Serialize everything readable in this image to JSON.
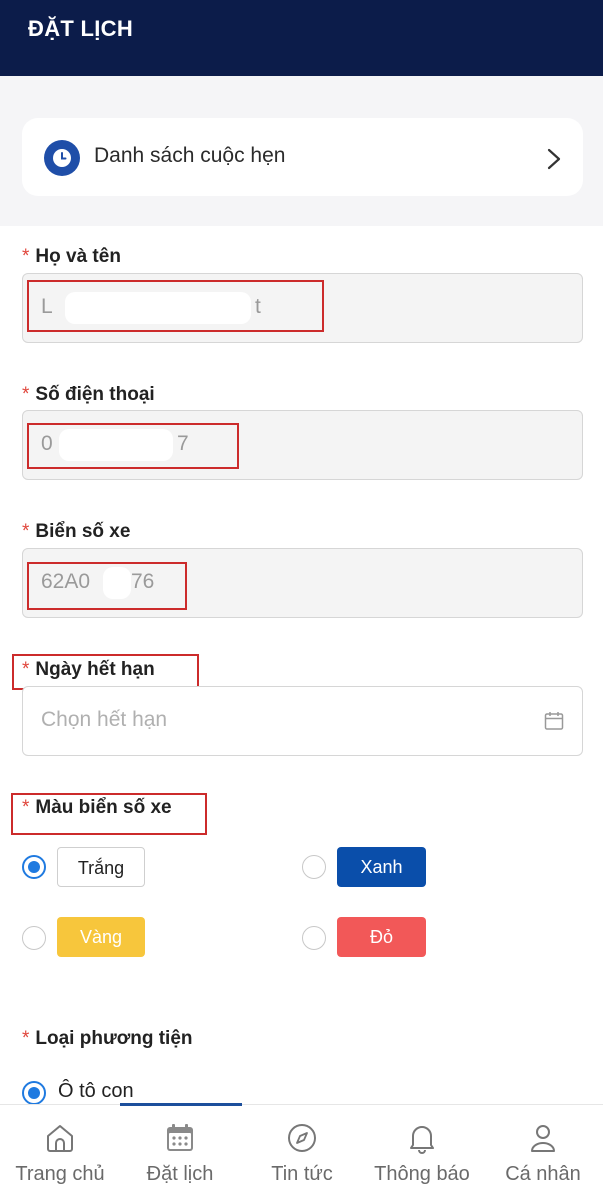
{
  "header": {
    "title": "ĐẶT LỊCH"
  },
  "appointments": {
    "label": "Danh sách cuộc hẹn"
  },
  "form": {
    "required_mark": "*",
    "full_name": {
      "label": "Họ và tên",
      "value_start": "L",
      "value_end": "t"
    },
    "phone": {
      "label": "Số điện thoại",
      "value_start": "0",
      "value_end": "7"
    },
    "plate": {
      "label": "Biển số xe",
      "value_start": "62A0",
      "value_end": "76"
    },
    "expiry": {
      "label": "Ngày hết hạn",
      "placeholder": "Chọn hết hạn"
    },
    "plate_color": {
      "label": "Màu biển số xe",
      "options": [
        {
          "label": "Trắng",
          "selected": true,
          "bg": "#ffffff",
          "fg": "#222222"
        },
        {
          "label": "Xanh",
          "selected": false,
          "bg": "#0a4eaa",
          "fg": "#ffffff"
        },
        {
          "label": "Vàng",
          "selected": false,
          "bg": "#f7c63c",
          "fg": "#ffffff"
        },
        {
          "label": "Đỏ",
          "selected": false,
          "bg": "#f25858",
          "fg": "#ffffff"
        }
      ]
    },
    "vehicle_type": {
      "label": "Loại phương tiện",
      "option": "Ô tô con"
    }
  },
  "bottom_nav": {
    "items": [
      {
        "label": "Trang chủ",
        "icon": "home-icon"
      },
      {
        "label": "Đặt lịch",
        "icon": "calendar-icon"
      },
      {
        "label": "Tin tức",
        "icon": "compass-icon"
      },
      {
        "label": "Thông báo",
        "icon": "bell-icon"
      },
      {
        "label": "Cá nhân",
        "icon": "user-icon"
      }
    ],
    "active_index": 1
  },
  "colors": {
    "header_bg": "#0c1c4a",
    "accent": "#1f7ae0",
    "required": "#e0463c",
    "annotation": "#cc2b2b"
  }
}
